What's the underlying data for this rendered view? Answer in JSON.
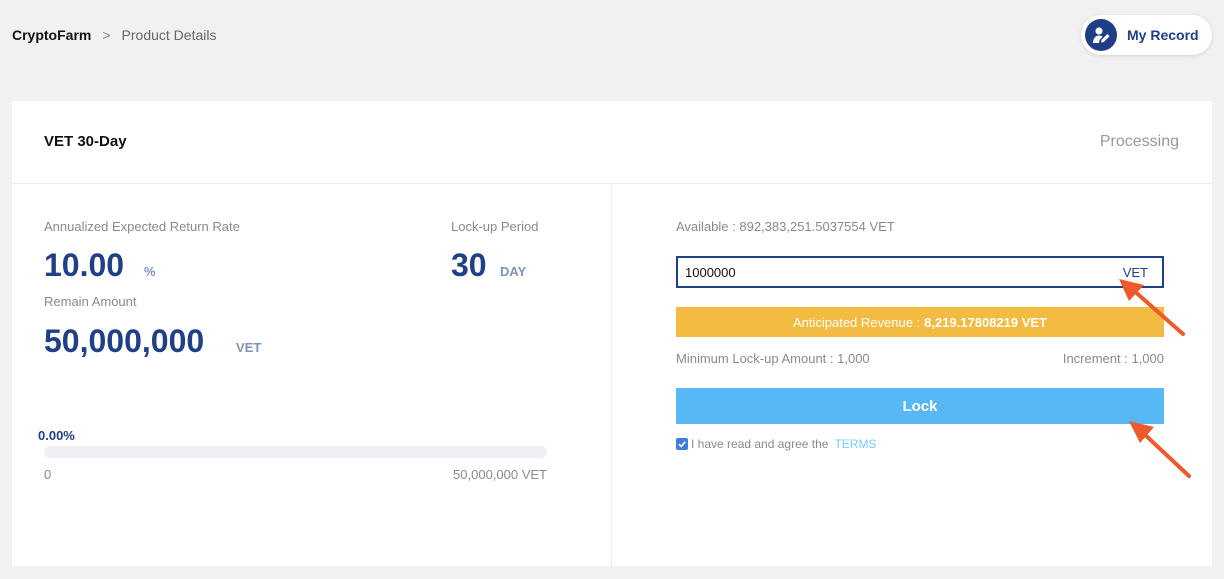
{
  "breadcrumb": {
    "home": "CryptoFarm",
    "separator": ">",
    "current": "Product Details"
  },
  "header": {
    "record_label": "My Record",
    "record_icon": "user-edit-icon"
  },
  "product": {
    "title": "VET 30-Day",
    "status": "Processing"
  },
  "stats": {
    "return_rate_label": "Annualized Expected Return Rate",
    "return_rate_value": "10.00",
    "return_rate_unit": "%",
    "lockup_label": "Lock-up Period",
    "lockup_value": "30",
    "lockup_unit": "DAY",
    "remain_label": "Remain Amount",
    "remain_value": "50,000,000",
    "remain_unit": "VET"
  },
  "progress": {
    "percent_text": "0.00%",
    "fraction": 0,
    "min_label": "0",
    "max_label": "50,000,000 VET"
  },
  "lock_form": {
    "available": "Available : 892,383,251.5037554 VET",
    "amount_value": "1000000",
    "amount_unit": "VET",
    "revenue_label": "Anticipated Revenue :",
    "revenue_value": "8,219.17808219 VET",
    "min_lockup": "Minimum Lock-up Amount : 1,000",
    "increment": "Increment : 1,000",
    "lock_label": "Lock",
    "terms_text": "I have read and agree the",
    "terms_link": "TERMS",
    "terms_checked": true
  },
  "colors": {
    "brand_navy": "#1f3f87",
    "revenue_orange": "#f4bb42",
    "lock_blue": "#58b8f5",
    "arrow_red": "#ee5a2a"
  }
}
